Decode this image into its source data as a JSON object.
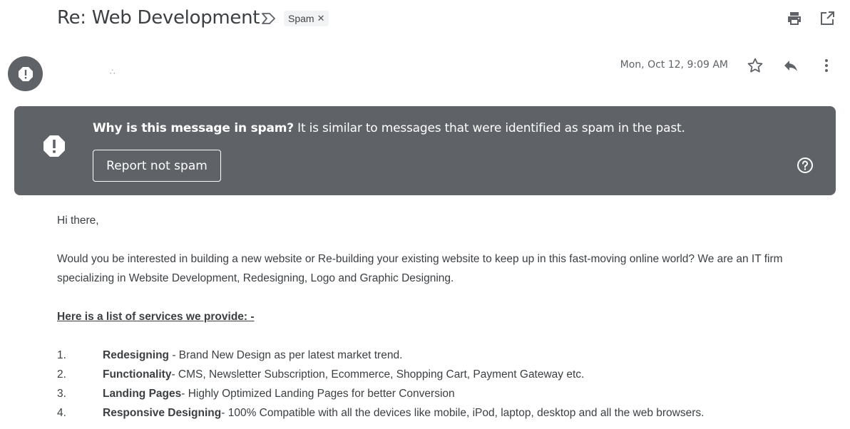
{
  "subject": "Re: Web Development",
  "label": {
    "name": "Spam",
    "remove_glyph": "✕"
  },
  "icons": {
    "label_arrow": "label-important-icon",
    "print": "print-icon",
    "open_new_window": "open-in-new-window-icon",
    "avatar": "exclamation-icon",
    "star": "star-icon",
    "reply": "reply-icon",
    "more": "more-vert-icon",
    "banner": "exclamation-icon",
    "help": "help-icon"
  },
  "sender_mark": "∴",
  "date": "Mon, Oct 12, 9:09 AM",
  "banner": {
    "question": "Why is this message in spam?",
    "explanation": " It is similar to messages that were identified as spam in the past.",
    "button": "Report not spam"
  },
  "body": {
    "greeting": "Hi there,",
    "paragraph": "Would you be interested in building a new website or Re-building your existing website to keep up in this fast-moving online world? We are an IT firm specializing in Website Development, Redesigning, Logo and Graphic Designing.",
    "services_title": "Here is a list of services we provide: -",
    "services": [
      {
        "num": "1.",
        "title": "Redesigning",
        "desc": " - Brand New Design as per latest market trend."
      },
      {
        "num": "2.",
        "title": "Functionality",
        "desc": "- CMS, Newsletter Subscription, Ecommerce, Shopping Cart, Payment Gateway etc."
      },
      {
        "num": "3.",
        "title": "Landing Pages",
        "desc": "- Highly Optimized Landing Pages for better Conversion"
      },
      {
        "num": "4.",
        "title": "Responsive Designing",
        "desc": "- 100% Compatible with all the devices like mobile, iPod, laptop, desktop and all the web browsers."
      }
    ]
  },
  "colors": {
    "banner_bg": "#5f6368",
    "text": "#3c4043",
    "icon": "#5f6368"
  }
}
